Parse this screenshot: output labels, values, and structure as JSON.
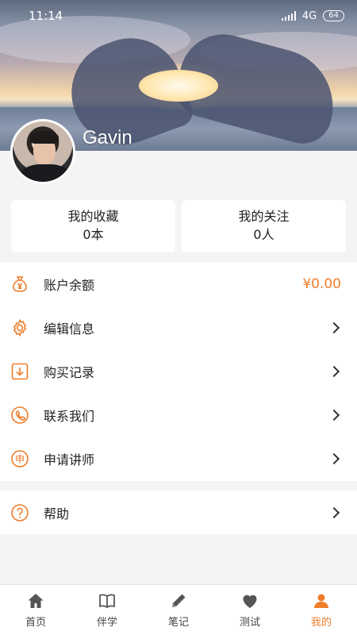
{
  "status_bar": {
    "time": "11:14",
    "network": "4G",
    "battery": "64"
  },
  "profile": {
    "name": "Gavin"
  },
  "stats": [
    {
      "title": "我的收藏",
      "value": "0本"
    },
    {
      "title": "我的关注",
      "value": "0人"
    }
  ],
  "menu": [
    {
      "label": "账户余额",
      "amount": "¥0.00",
      "icon": "money-bag-icon"
    },
    {
      "label": "编辑信息",
      "icon": "gear-icon"
    },
    {
      "label": "购买记录",
      "icon": "download-icon"
    },
    {
      "label": "联系我们",
      "icon": "phone-icon"
    },
    {
      "label": "申请讲师",
      "icon": "apply-icon",
      "icon_text": "申"
    }
  ],
  "help": {
    "label": "帮助",
    "icon": "help-icon"
  },
  "tabs": [
    {
      "label": "首页",
      "icon": "home-icon"
    },
    {
      "label": "伴学",
      "icon": "book-icon"
    },
    {
      "label": "笔记",
      "icon": "pencil-icon"
    },
    {
      "label": "测试",
      "icon": "heart-icon"
    },
    {
      "label": "我的",
      "icon": "user-icon",
      "active": true
    }
  ],
  "colors": {
    "accent": "#ee7d2c",
    "background": "#f4f4f4"
  }
}
